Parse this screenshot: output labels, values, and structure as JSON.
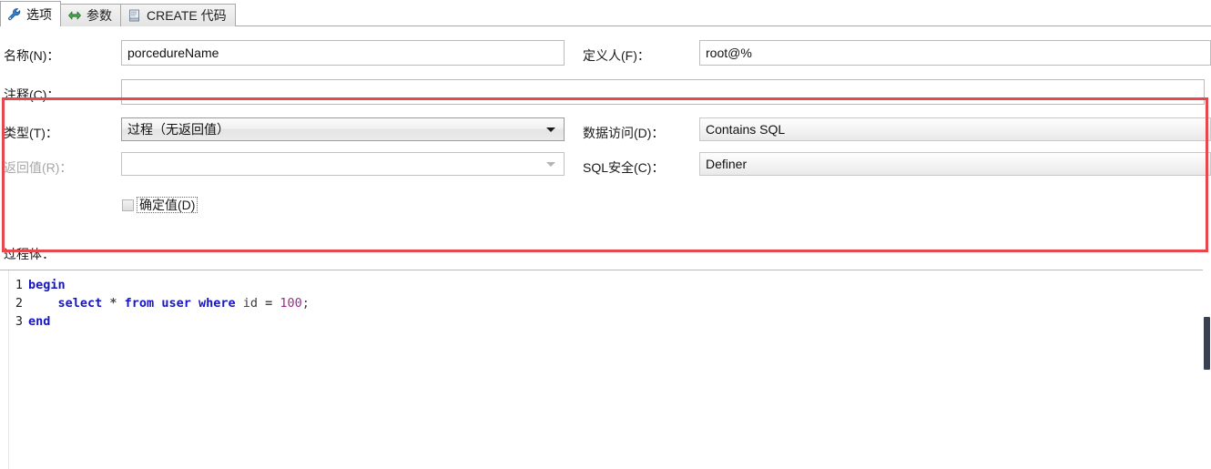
{
  "tabs": [
    {
      "label": "选项",
      "icon": "wrench-icon",
      "active": true
    },
    {
      "label": "参数",
      "icon": "double-arrow-icon",
      "active": false
    },
    {
      "label": "CREATE 代码",
      "icon": "document-icon",
      "active": false
    }
  ],
  "form": {
    "name_label": "名称(N)：",
    "name_value": "porcedureName",
    "definer_label": "定义人(F)：",
    "definer_value": "root@%",
    "comment_label": "注释(C)：",
    "comment_value": "",
    "type_label": "类型(T)：",
    "type_value": "过程（无返回值）",
    "data_access_label": "数据访问(D)：",
    "data_access_value": "Contains SQL",
    "return_label": "返回值(R)：",
    "return_value": "",
    "sql_security_label": "SQL安全(C)：",
    "sql_security_value": "Definer",
    "deterministic_label": "确定值(D)",
    "deterministic_checked": false
  },
  "body": {
    "label": "过程体：",
    "lines": [
      {
        "no": "1",
        "tokens": [
          {
            "t": "begin",
            "c": "kw"
          }
        ]
      },
      {
        "no": "2",
        "tokens": [
          {
            "t": "    select ",
            "c": "kw"
          },
          {
            "t": "* ",
            "c": "op"
          },
          {
            "t": "from ",
            "c": "kw"
          },
          {
            "t": "user ",
            "c": "kw"
          },
          {
            "t": "where ",
            "c": "kw"
          },
          {
            "t": "id ",
            "c": "ident"
          },
          {
            "t": "= ",
            "c": "op"
          },
          {
            "t": "100",
            "c": "num"
          },
          {
            "t": ";",
            "c": "punct"
          }
        ]
      },
      {
        "no": "3",
        "tokens": [
          {
            "t": "end",
            "c": "kw"
          }
        ]
      }
    ]
  },
  "colors": {
    "highlight_red": "#e8474c",
    "keyword_blue": "#1515c6",
    "number_magenta": "#a0288f",
    "scrollbar_thumb": "#3a4050"
  }
}
